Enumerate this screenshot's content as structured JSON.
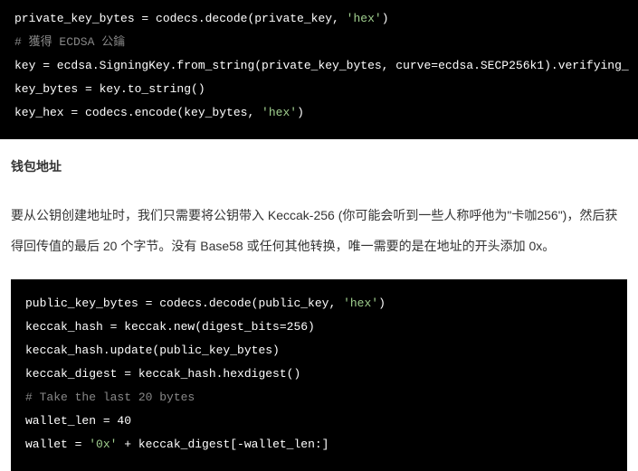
{
  "codeBlock1": {
    "line1_pre": "private_key_bytes = codecs.decode(private_key, ",
    "line1_str": "'hex'",
    "line1_post": ")",
    "line2": "# 獲得 ECDSA 公鑰",
    "line3": "key = ecdsa.SigningKey.from_string(private_key_bytes, curve=ecdsa.SECP256k1).verifying_",
    "line4": "key_bytes = key.to_string()",
    "line5_pre": "key_hex = codecs.encode(key_bytes, ",
    "line5_str": "'hex'",
    "line5_post": ")"
  },
  "section": {
    "heading": "钱包地址",
    "paragraph": "要从公钥创建地址时，我们只需要将公钥带入 Keccak-256 (你可能会听到一些人称呼他为\"卡咖256\")，然后获得回传值的最后 20 个字节。没有 Base58 或任何其他转换，唯一需要的是在地址的开头添加 0x。"
  },
  "codeBlock2": {
    "line1_pre": "public_key_bytes = codecs.decode(public_key, ",
    "line1_str": "'hex'",
    "line1_post": ")",
    "line2": "keccak_hash = keccak.new(digest_bits=256)",
    "line3": "keccak_hash.update(public_key_bytes)",
    "line4": "keccak_digest = keccak_hash.hexdigest()",
    "line5": "# Take the last 20 bytes",
    "line6": "wallet_len = 40",
    "line7_pre": "wallet = ",
    "line7_str": "'0x'",
    "line7_post": " + keccak_digest[-wallet_len:]"
  }
}
